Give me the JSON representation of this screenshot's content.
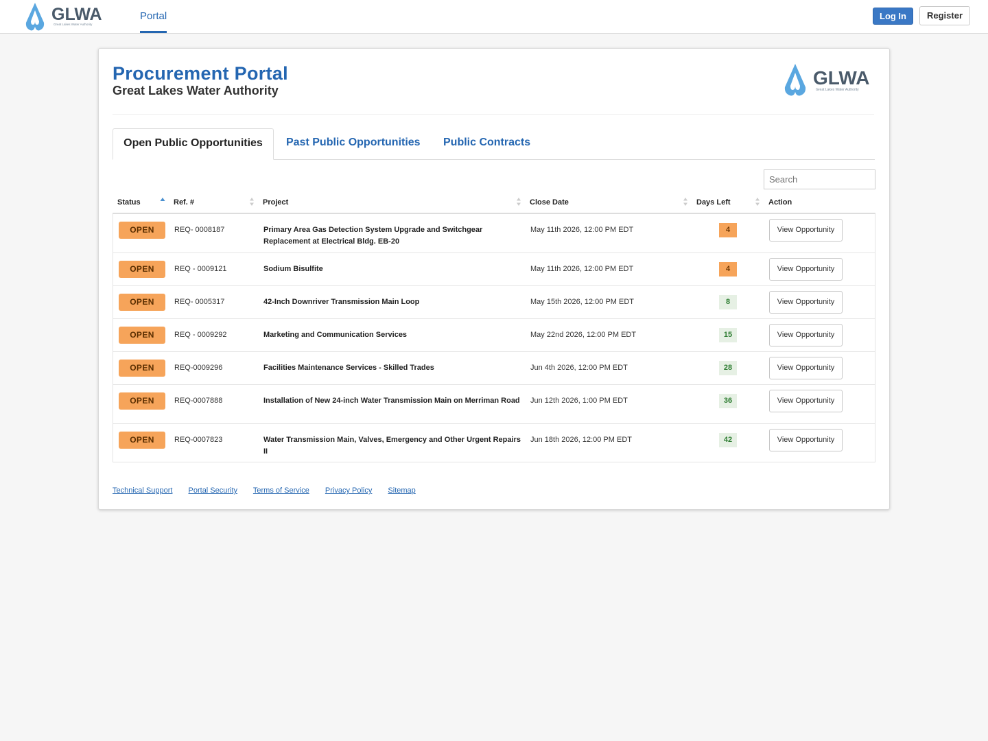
{
  "nav": {
    "logo_text": "GLWA",
    "logo_tagline": "Great Lakes Water Authority",
    "portal_tab": "Portal",
    "login_label": "Log In",
    "register_label": "Register"
  },
  "header": {
    "title": "Procurement Portal",
    "subtitle": "Great Lakes Water Authority"
  },
  "tabs": [
    {
      "label": "Open Public Opportunities",
      "active": true
    },
    {
      "label": "Past Public Opportunities",
      "active": false
    },
    {
      "label": "Public Contracts",
      "active": false
    }
  ],
  "search": {
    "placeholder": "Search"
  },
  "table": {
    "columns": [
      "Status",
      "Ref. #",
      "Project",
      "Close Date",
      "Days Left",
      "Action"
    ],
    "rows": [
      {
        "status": "OPEN",
        "ref": "REQ- 0008187",
        "project": "Primary Area Gas Detection System Upgrade and Switchgear Replacement at Electrical Bldg. EB-20",
        "close_date": "May 11th 2026, 12:00 PM EDT",
        "days_left": "4",
        "days_level": "warn",
        "action": "View Opportunity"
      },
      {
        "status": "OPEN",
        "ref": "REQ - 0009121",
        "project": "Sodium Bisulfite",
        "close_date": "May 11th 2026, 12:00 PM EDT",
        "days_left": "4",
        "days_level": "warn",
        "action": "View Opportunity"
      },
      {
        "status": "OPEN",
        "ref": "REQ- 0005317",
        "project": "42-Inch Downriver Transmission Main Loop",
        "close_date": "May 15th 2026, 12:00 PM EDT",
        "days_left": "8",
        "days_level": "ok",
        "action": "View Opportunity"
      },
      {
        "status": "OPEN",
        "ref": "REQ - 0009292",
        "project": "Marketing and Communication Services",
        "close_date": "May 22nd 2026, 12:00 PM EDT",
        "days_left": "15",
        "days_level": "ok",
        "action": "View Opportunity"
      },
      {
        "status": "OPEN",
        "ref": "REQ-0009296",
        "project": "Facilities Maintenance Services - Skilled Trades",
        "close_date": "Jun 4th 2026, 12:00 PM EDT",
        "days_left": "28",
        "days_level": "ok",
        "action": "View Opportunity"
      },
      {
        "status": "OPEN",
        "ref": "REQ-0007888",
        "project": "Installation of New 24-inch Water Transmission Main on Merriman Road",
        "close_date": "Jun 12th 2026, 1:00 PM EDT",
        "days_left": "36",
        "days_level": "ok",
        "action": "View Opportunity"
      },
      {
        "status": "OPEN",
        "ref": "REQ-0007823",
        "project": "Water Transmission Main, Valves, Emergency and Other Urgent Repairs II",
        "close_date": "Jun 18th 2026, 12:00 PM EDT",
        "days_left": "42",
        "days_level": "ok",
        "action": "View Opportunity"
      }
    ]
  },
  "footer": {
    "links": [
      "Technical Support",
      "Portal Security",
      "Terms of Service",
      "Privacy Policy",
      "Sitemap"
    ]
  },
  "colors": {
    "brand_blue": "#2466b1",
    "logo_light_blue": "#5aa7e0",
    "open_badge": "#f6a45a",
    "days_ok_bg": "#e6f0e4"
  }
}
